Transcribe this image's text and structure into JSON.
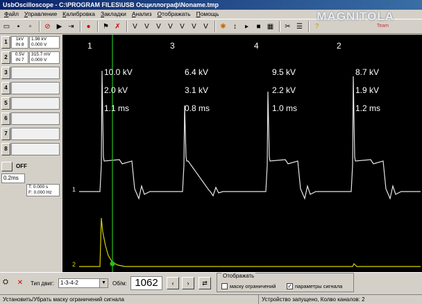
{
  "window": {
    "title": "UsbOscilloscope - C:\\PROGRAM FILES\\USB Осциллограф\\Noname.tmp"
  },
  "logo": {
    "text": "MAGNITOLA",
    "sub": "Team"
  },
  "menu": [
    "Файл",
    "Управление",
    "Калибровка",
    "Закладки",
    "Анализ",
    "Отображать",
    "Помощь"
  ],
  "channels": [
    {
      "id": "1",
      "scale": "1kV",
      "mode": "IN 8",
      "v1": "1.98 kV",
      "v2": "0.000 V"
    },
    {
      "id": "2",
      "scale": "0.5V",
      "mode": "IN 7",
      "v1": "315.7 mV",
      "v2": "0.000 V"
    },
    {
      "id": "3",
      "v1": "",
      "v2": ""
    },
    {
      "id": "4",
      "v1": "",
      "v2": ""
    },
    {
      "id": "5",
      "v1": "",
      "v2": ""
    },
    {
      "id": "6",
      "v1": "",
      "v2": ""
    },
    {
      "id": "7",
      "v1": "",
      "v2": ""
    },
    {
      "id": "8",
      "v1": "",
      "v2": ""
    }
  ],
  "sweep": {
    "off_label": "OFF",
    "timebase": "0.2ms",
    "t_label": "T: 0.000 s",
    "f_label": "F: 0.000 Hz"
  },
  "scope": {
    "cylinders": [
      {
        "cyl": "1",
        "kv": "10.0 kV",
        "burn_kv": "2.0 kV",
        "burn_time": "1.1 ms"
      },
      {
        "cyl": "3",
        "kv": "6.4 kV",
        "burn_kv": "3.1 kV",
        "burn_time": "0.8 ms"
      },
      {
        "cyl": "4",
        "kv": "9.5 kV",
        "burn_kv": "2.2 kV",
        "burn_time": "1.0 ms"
      },
      {
        "cyl": "2",
        "kv": "8.7 kV",
        "burn_kv": "1.9 kV",
        "burn_time": "1.2 ms"
      }
    ],
    "trace1_marker": "1",
    "trace2_marker": "2",
    "trace1_color": "#e6e6e6",
    "trace2_color": "#d8d000",
    "cursor_color": "#22c022"
  },
  "bottom": {
    "firing_label": "Тип двиг:",
    "firing_order": "1-3-4-2",
    "rpm_label": "Об/м:",
    "rpm_value": "1062",
    "display_group": "Отображать",
    "mask_label": "маску ограничений",
    "params_label": "параметры сигнала"
  },
  "status": {
    "left": "Установить/Убрать маску ограничений сигнала",
    "right": "Устройство запущено, Колво каналов: 2"
  }
}
